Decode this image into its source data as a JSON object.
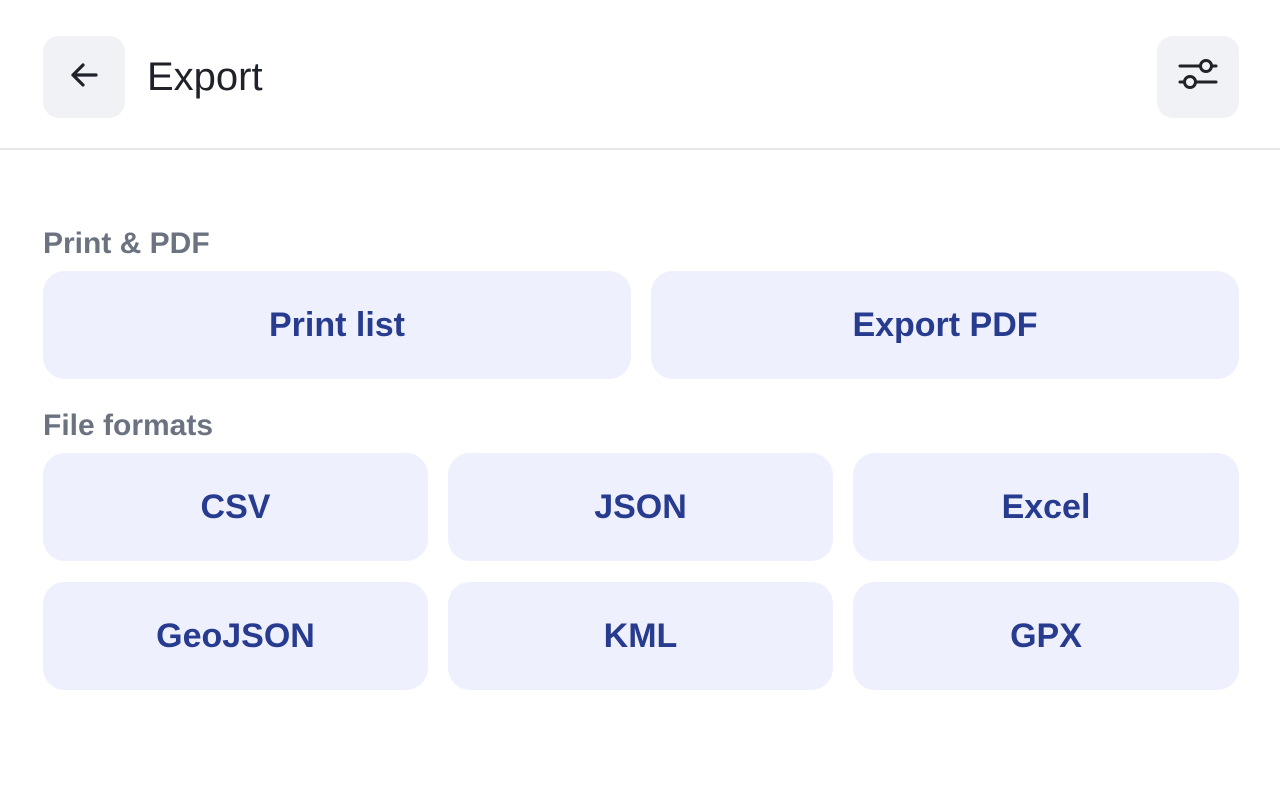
{
  "header": {
    "title": "Export",
    "back_icon": "arrow-left-icon",
    "filter_icon": "sliders-icon"
  },
  "sections": [
    {
      "label": "Print & PDF",
      "buttons": [
        "Print list",
        "Export PDF"
      ]
    },
    {
      "label": "File formats",
      "buttons": [
        "CSV",
        "JSON",
        "Excel",
        "GeoJSON",
        "KML",
        "GPX"
      ]
    }
  ],
  "colors": {
    "tile_bg": "#eef0fd",
    "tile_text": "#273b8f",
    "section_label": "#6b7280",
    "icon_button_bg": "#f1f2f5",
    "divider": "#e6e7eb"
  }
}
